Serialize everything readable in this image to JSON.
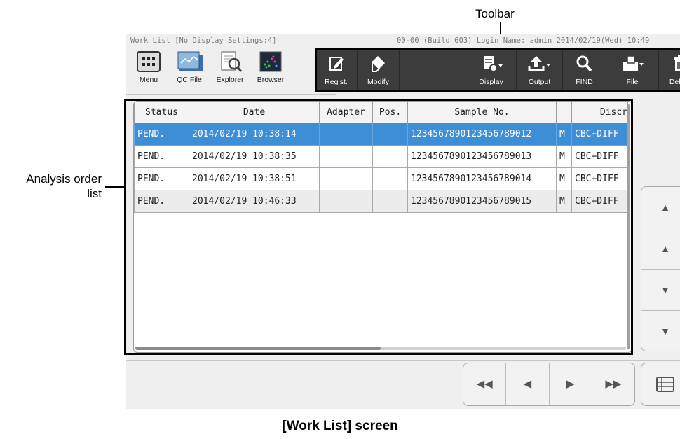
{
  "annotations": {
    "toolbar": "Toolbar",
    "order_list_line1": "Analysis order",
    "order_list_line2": "list",
    "caption": "[Work List] screen"
  },
  "status_line": {
    "left": "Work List [No Display Settings:4]",
    "right": "00-00 (Build 603) Login Name: admin  2014/02/19(Wed) 10:49"
  },
  "launchers": [
    {
      "label": "Menu",
      "icon": "menu-grid-icon"
    },
    {
      "label": "QC File",
      "icon": "qc-file-icon"
    },
    {
      "label": "Explorer",
      "icon": "explorer-icon"
    },
    {
      "label": "Browser",
      "icon": "browser-icon"
    }
  ],
  "toolbar": {
    "regist": "Regist.",
    "modify": "Modify",
    "display": "Display",
    "output": "Output",
    "find": "FIND",
    "file": "File",
    "delete": "Delete"
  },
  "table": {
    "headers": [
      "Status",
      "Date",
      "Adapter",
      "Pos.",
      "Sample No.",
      "",
      "Discr"
    ],
    "rows": [
      {
        "status": "PEND.",
        "date": "2014/02/19 10:38:14",
        "adapter": "",
        "pos": "",
        "sample": "1234567890123456789012",
        "m": "M",
        "discr": "CBC+DIFF"
      },
      {
        "status": "PEND.",
        "date": "2014/02/19 10:38:35",
        "adapter": "",
        "pos": "",
        "sample": "1234567890123456789013",
        "m": "M",
        "discr": "CBC+DIFF"
      },
      {
        "status": "PEND.",
        "date": "2014/02/19 10:38:51",
        "adapter": "",
        "pos": "",
        "sample": "1234567890123456789014",
        "m": "M",
        "discr": "CBC+DIFF"
      },
      {
        "status": "PEND.",
        "date": "2014/02/19 10:46:33",
        "adapter": "",
        "pos": "",
        "sample": "1234567890123456789015",
        "m": "M",
        "discr": "CBC+DIFF"
      }
    ],
    "selected_row": 0
  },
  "colors": {
    "toolbar_bg": "#3c3c3c",
    "selected_row": "#3d8ed4"
  }
}
